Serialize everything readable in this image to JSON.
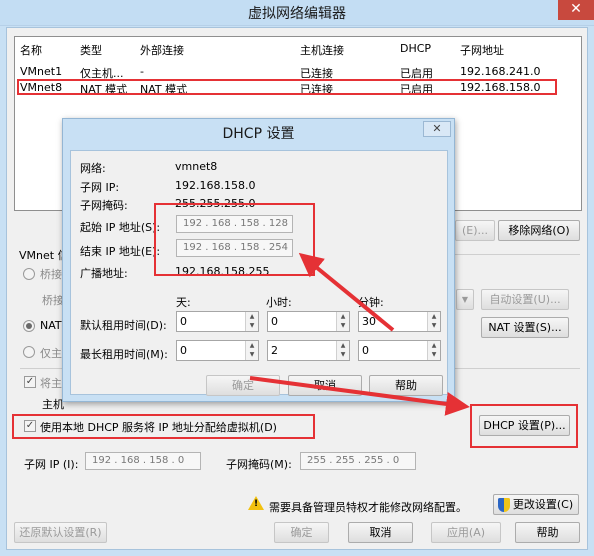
{
  "window": {
    "title": "虚拟网络编辑器",
    "close_glyph": "✕"
  },
  "table": {
    "headers": [
      "名称",
      "类型",
      "外部连接",
      "主机连接",
      "DHCP",
      "子网地址"
    ],
    "rows": [
      [
        "VMnet1",
        "仅主机...",
        "-",
        "已连接",
        "已启用",
        "192.168.241.0"
      ],
      [
        "VMnet8",
        "NAT 模式",
        "NAT 模式",
        "已连接",
        "已启用",
        "192.168.158.0"
      ]
    ]
  },
  "table_buttons": {
    "add": "(E)...",
    "remove": "移除网络(O)"
  },
  "vmnet": {
    "info_label": "VMnet 信",
    "bridge_label": "桥接",
    "bridge_to_label": "桥接",
    "nat_label": "NAT",
    "host_only_label": "仅主",
    "connect_label": "将主",
    "host_label": "主机",
    "dhcp_checkbox_label": "使用本地 DHCP 服务将 IP 地址分配给虚拟机(D)",
    "auto_settings": "自动设置(U)...",
    "nat_settings": "NAT 设置(S)...",
    "dhcp_settings": "DHCP 设置(P)...",
    "subnet_ip_label": "子网 IP (I):",
    "subnet_ip": "192 . 168 . 158 .  0",
    "subnet_mask_label": "子网掩码(M):",
    "subnet_mask": "255 . 255 . 255 .  0"
  },
  "admin_notice": "需要具备管理员特权才能修改网络配置。",
  "change_settings": "更改设置(C)",
  "bottom": {
    "restore": "还原默认设置(R)",
    "ok": "确定",
    "cancel": "取消",
    "apply": "应用(A)",
    "help": "帮助"
  },
  "dhcp_dialog": {
    "title": "DHCP 设置",
    "close_glyph": "✕",
    "network_label": "网络:",
    "network_value": "vmnet8",
    "subnet_ip_label": "子网 IP:",
    "subnet_ip_value": "192.168.158.0",
    "subnet_mask_label": "子网掩码:",
    "subnet_mask_value": "255.255.255.0",
    "start_ip_label": "起始 IP 地址(S):",
    "start_ip_value": "192 . 168 . 158 . 128",
    "end_ip_label": "结束 IP 地址(E):",
    "end_ip_value": "192 . 168 . 158 . 254",
    "broadcast_label": "广播地址:",
    "broadcast_value": "192.168.158.255",
    "days_label": "天:",
    "hours_label": "小时:",
    "minutes_label": "分钟:",
    "default_lease_label": "默认租用时间(D):",
    "default_lease": {
      "days": "0",
      "hours": "0",
      "minutes": "30"
    },
    "max_lease_label": "最长租用时间(M):",
    "max_lease": {
      "days": "0",
      "hours": "2",
      "minutes": "0"
    },
    "ok": "确定",
    "cancel": "取消",
    "help": "帮助"
  },
  "annotation_color": "#e53135"
}
